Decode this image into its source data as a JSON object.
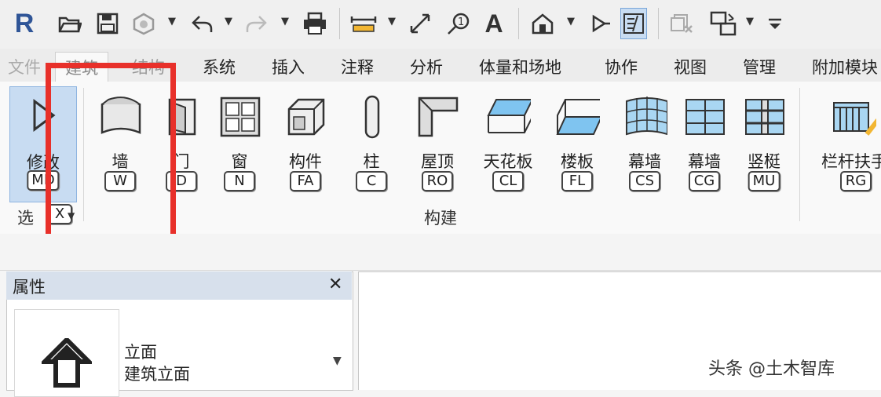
{
  "quick_access": {
    "logo": "R",
    "items": [
      "revit-logo-icon",
      "open-icon",
      "save-icon",
      "sync-icon",
      "undo-icon",
      "redo-icon",
      "print-icon",
      "measure-icon",
      "align-dimension-icon",
      "tag-icon",
      "text-icon",
      "3d-view-icon",
      "section-icon",
      "thin-lines-icon",
      "close-hidden-icon",
      "switch-windows-icon",
      "customize-icon"
    ],
    "text_glyph": "A"
  },
  "tabs": {
    "file": "文件",
    "architecture": "建筑",
    "structure": "结构",
    "systems": "系统",
    "insert": "插入",
    "annotate": "注释",
    "analyze": "分析",
    "massing": "体量和场地",
    "collaborate": "协作",
    "view": "视图",
    "manage": "管理",
    "addins": "附加模块"
  },
  "ribbon": {
    "modify": {
      "label": "修改",
      "key": "MD"
    },
    "select": {
      "label": "选",
      "key": "X"
    },
    "tools": [
      {
        "label": "墙",
        "key": "W",
        "icon": "wall-icon"
      },
      {
        "label": "门",
        "key": "D",
        "icon": "door-icon"
      },
      {
        "label": "窗",
        "key": "N",
        "icon": "window-icon"
      },
      {
        "label": "构件",
        "key": "FA",
        "icon": "component-icon"
      },
      {
        "label": "柱",
        "key": "C",
        "icon": "column-icon"
      },
      {
        "label": "屋顶",
        "key": "RO",
        "icon": "roof-icon"
      },
      {
        "label": "天花板",
        "key": "CL",
        "icon": "ceiling-icon"
      },
      {
        "label": "楼板",
        "key": "FL",
        "icon": "floor-icon"
      },
      {
        "label": "幕墙",
        "key": "CS",
        "icon": "curtain-system-icon"
      },
      {
        "label": "幕墙",
        "key": "CG",
        "icon": "curtain-grid-icon"
      },
      {
        "label": "竖梃",
        "key": "MU",
        "icon": "mullion-icon"
      },
      {
        "label": "栏杆扶手",
        "key": "RG",
        "icon": "railing-icon"
      }
    ],
    "panel_label": "构建"
  },
  "properties": {
    "title": "属性",
    "close": "✕",
    "type_line1": "立面",
    "type_line2": "建筑立面"
  },
  "watermark": "头条 @土木智库",
  "colors": {
    "highlight": "#e8302a",
    "revit_blue": "#2f5597",
    "panel_header": "#d7e0ec"
  }
}
